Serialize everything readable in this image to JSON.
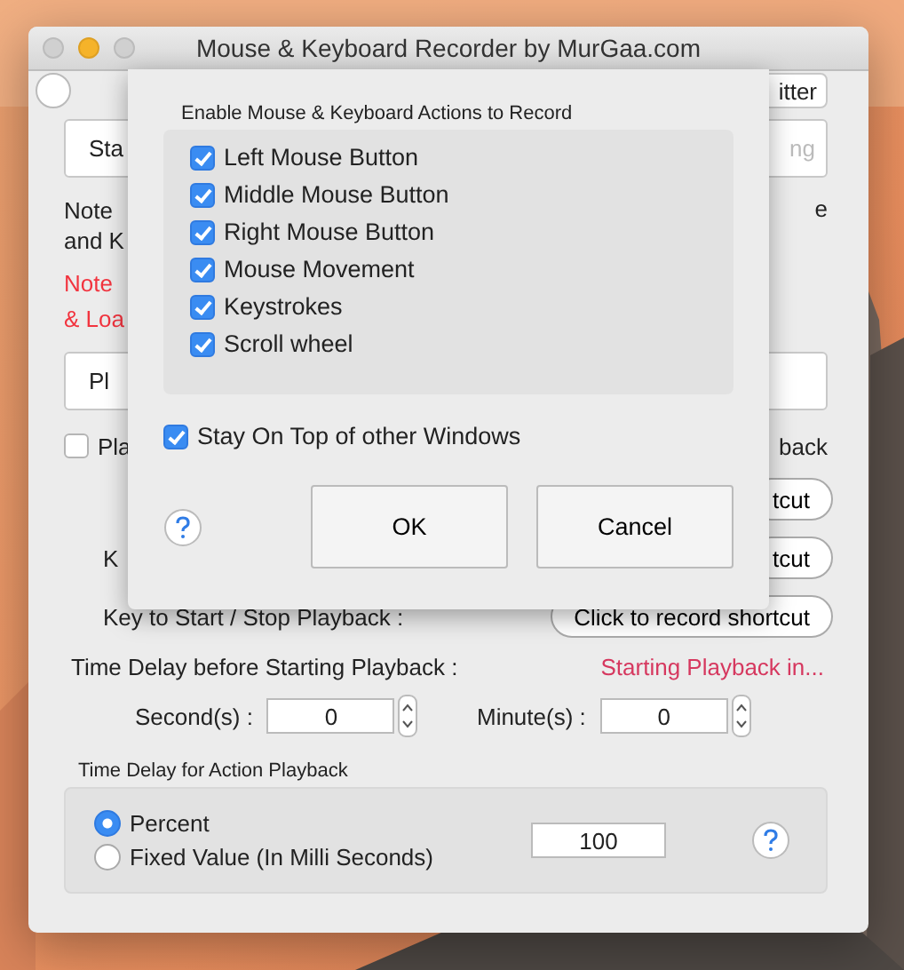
{
  "window": {
    "title": "Mouse & Keyboard Recorder by MurGaa.com"
  },
  "main": {
    "top_button": "itter",
    "start_button": "Sta",
    "stop_button": {
      "label": "ng",
      "disabled": true
    },
    "note": [
      "Note",
      "and K"
    ],
    "note_right": "e",
    "red_note": [
      "Note",
      "& Loa"
    ],
    "play_button": "Pl",
    "play_checkbox": {
      "label": "Pla",
      "checked": false
    },
    "play_right_label": "back",
    "shortcut_rows": [
      {
        "label": "",
        "button": "tcut"
      },
      {
        "label": "K",
        "button": "tcut"
      },
      {
        "label": "Key to Start / Stop Playback  :",
        "button": "Click to record shortcut"
      }
    ],
    "delay_label": "Time Delay before Starting Playback :",
    "delay_status": "Starting Playback in...",
    "seconds": {
      "label": "Second(s) :",
      "value": "0"
    },
    "minutes": {
      "label": "Minute(s) :",
      "value": "0"
    },
    "action_delay": {
      "title": "Time Delay for Action Playback",
      "options": [
        {
          "label": "Percent",
          "selected": true
        },
        {
          "label": "Fixed Value (In Milli Seconds)",
          "selected": false
        }
      ],
      "value": "100"
    }
  },
  "dialog": {
    "group_title": "Enable Mouse & Keyboard Actions to Record",
    "actions": [
      {
        "label": "Left Mouse Button",
        "checked": true
      },
      {
        "label": "Middle Mouse Button",
        "checked": true
      },
      {
        "label": "Right Mouse Button",
        "checked": true
      },
      {
        "label": "Mouse Movement",
        "checked": true
      },
      {
        "label": "Keystrokes",
        "checked": true
      },
      {
        "label": "Scroll wheel",
        "checked": true
      }
    ],
    "stay_on_top": {
      "label": "Stay On Top of other Windows",
      "checked": true
    },
    "buttons": [
      "OK",
      "Cancel"
    ]
  }
}
